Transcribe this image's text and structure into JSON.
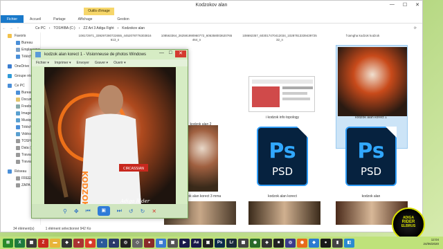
{
  "window": {
    "title": "Kodzokov alan",
    "contextual_tab": "Outils d'image",
    "controls": {
      "minimize": "—",
      "maximize": "☐",
      "close": "✕"
    }
  },
  "ribbon": {
    "tabs": [
      "Fichier",
      "Accueil",
      "Partage",
      "Affichage",
      "Gestion"
    ]
  },
  "address": {
    "back": "←",
    "forward": "→",
    "up": "↑",
    "crumbs": [
      "Ce PC",
      "TOSHIBA (C:)",
      "ZZ Art 3 Adiga Fight",
      "Kodzokov alan"
    ],
    "refresh": "⟳"
  },
  "nav": {
    "items": [
      {
        "label": "Favoris",
        "sub": false,
        "color": "#f2c24a"
      },
      {
        "label": "Bureau",
        "sub": true,
        "color": "#4a8fd8"
      },
      {
        "label": "Emplacements récents",
        "sub": true,
        "color": "#7aa0c8"
      },
      {
        "label": "Téléchargements",
        "sub": true,
        "color": "#4a8fd8"
      },
      {
        "label": "OneDrive",
        "sub": false,
        "color": "#3a7dd0"
      },
      {
        "label": "Groupe résidentiel",
        "sub": false,
        "color": "#2f9ad8"
      },
      {
        "label": "Ce PC",
        "sub": false,
        "color": "#4a8fd8"
      },
      {
        "label": "Bureau",
        "sub": true,
        "color": "#4a8fd8"
      },
      {
        "label": "Documents",
        "sub": true,
        "color": "#e2c46a"
      },
      {
        "label": "Freebox",
        "sub": true,
        "color": "#8aa"
      },
      {
        "label": "Images",
        "sub": true,
        "color": "#5aa0d0"
      },
      {
        "label": "Musique",
        "sub": true,
        "color": "#5aa0d0"
      },
      {
        "label": "Téléchargements",
        "sub": true,
        "color": "#4a8fd8"
      },
      {
        "label": "Vidéos",
        "sub": true,
        "color": "#5aa0d0"
      },
      {
        "label": "TOSHIBA (C:)",
        "sub": true,
        "color": "#999"
      },
      {
        "label": "Data (D:)",
        "sub": true,
        "color": "#999"
      },
      {
        "label": "Travaux",
        "sub": true,
        "color": "#999"
      },
      {
        "label": "Travaux",
        "sub": true,
        "color": "#999"
      },
      {
        "label": "Réseau",
        "sub": false,
        "color": "#4a8fd8"
      },
      {
        "label": "FREEBOX",
        "sub": true,
        "color": "#999"
      },
      {
        "label": "ZAPA",
        "sub": true,
        "color": "#999"
      }
    ]
  },
  "files": {
    "top_names": [
      "108172971_339297280722655_4452078776303816 613_n",
      "108563364_262591990960772_606358003620765 464_n",
      "108692357_603017470412034_10287813339439725 32_n",
      "f tamgha kodzok kodzok"
    ],
    "captions": [
      "kodzok alan 2",
      "i kodzok info topology",
      "kodzok alan korect 1",
      "kodzok alan korect 3 mma",
      "kodzok alan korect",
      "kodzok alan"
    ],
    "psd_top": "Ps",
    "psd_bottom": "PSD"
  },
  "viewer": {
    "title": "kodzok alan korect 1 - Visionneuse de photos Windows",
    "menu": [
      "Fichier ▾",
      "Imprimer ▾",
      "Envoyer",
      "Graver ▾",
      "Ouvrir ▾"
    ],
    "image_text": "KODZOK",
    "image_badge": "CIRCASSIAN",
    "image_watermark": "Adiga Rider",
    "tools": {
      "zoom": "⚲",
      "fit": "✥",
      "prev": "⏮",
      "play": "▣",
      "next": "⏭",
      "rot_left": "↺",
      "rot_right": "↻",
      "delete": "✕"
    },
    "window_controls": {
      "minimize": "—",
      "maximize": "☐",
      "close": "✕"
    }
  },
  "status": {
    "count": "34 élément(s)",
    "selection": "1 élément sélectionné  942 Ko"
  },
  "taskbar": {
    "apps": [
      {
        "name": "start",
        "glyph": "⊞",
        "color": "#2a8a2a"
      },
      {
        "name": "excel",
        "glyph": "X",
        "color": "#1f7a3e"
      },
      {
        "name": "calc",
        "glyph": "▦",
        "color": "#3a3a3a"
      },
      {
        "name": "filezilla",
        "glyph": "Z",
        "color": "#c8281e"
      },
      {
        "name": "folder",
        "glyph": "▬",
        "color": "#e8b43a"
      },
      {
        "name": "app5",
        "glyph": "◆",
        "color": "#333"
      },
      {
        "name": "mic",
        "glyph": "●",
        "color": "#a33"
      },
      {
        "name": "chrome",
        "glyph": "◉",
        "color": "#d83a2a"
      },
      {
        "name": "app8",
        "glyph": "◐",
        "color": "#2a5a9a"
      },
      {
        "name": "app9",
        "glyph": "▲",
        "color": "#2a3a6a"
      },
      {
        "name": "app10",
        "glyph": "◎",
        "color": "#222"
      },
      {
        "name": "app11",
        "glyph": "◇",
        "color": "#666"
      },
      {
        "name": "app12",
        "glyph": "●",
        "color": "#8a2a2a"
      },
      {
        "name": "app13",
        "glyph": "▤",
        "color": "#3a7ad0"
      },
      {
        "name": "app14",
        "glyph": "▣",
        "color": "#555"
      },
      {
        "name": "app15",
        "glyph": "▶",
        "color": "#1a1a4a"
      },
      {
        "name": "after-effects",
        "glyph": "Ae",
        "color": "#1a1a4a"
      },
      {
        "name": "app17",
        "glyph": "▣",
        "color": "#222"
      },
      {
        "name": "photoshop",
        "glyph": "Ps",
        "color": "#0a2a4a"
      },
      {
        "name": "lightroom",
        "glyph": "Lr",
        "color": "#1a2a3a"
      },
      {
        "name": "app20",
        "glyph": "▩",
        "color": "#444"
      },
      {
        "name": "app21",
        "glyph": "◉",
        "color": "#2a6a2a"
      },
      {
        "name": "app22",
        "glyph": "◈",
        "color": "#333"
      },
      {
        "name": "app23",
        "glyph": "■",
        "color": "#222"
      },
      {
        "name": "app24",
        "glyph": "◎",
        "color": "#3a3a8a"
      },
      {
        "name": "firefox",
        "glyph": "◉",
        "color": "#e86a1a"
      },
      {
        "name": "app26",
        "glyph": "◆",
        "color": "#2a7ad0"
      },
      {
        "name": "app27",
        "glyph": "●",
        "color": "#1a1a1a"
      },
      {
        "name": "app28",
        "glyph": "▮",
        "color": "#444"
      },
      {
        "name": "app29",
        "glyph": "◧",
        "color": "#2a8ad0"
      }
    ],
    "time": "12:04",
    "date": "24/06/2020"
  },
  "badge": {
    "line1": "ADIGA",
    "line2": "RIDER",
    "line3": "ELBRUS"
  }
}
